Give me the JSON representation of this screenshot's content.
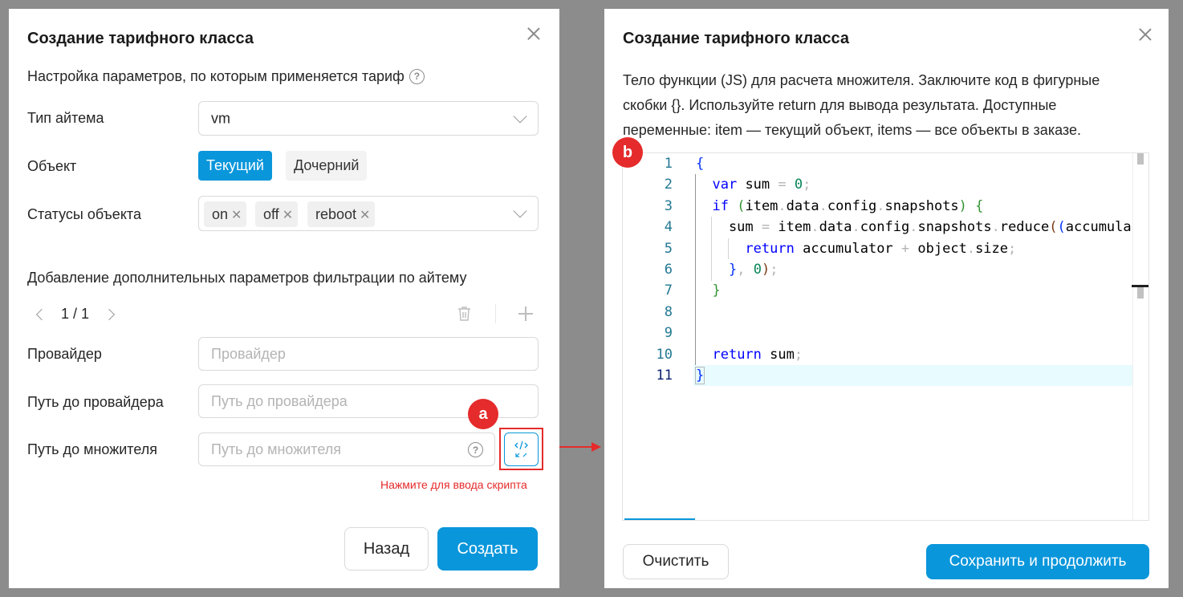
{
  "left_modal": {
    "title": "Создание тарифного класса",
    "subtitle": "Настройка параметров, по которым применяется тариф",
    "item_type": {
      "label": "Тип айтема",
      "value": "vm"
    },
    "object": {
      "label": "Объект",
      "options": [
        "Текущий",
        "Дочерний"
      ],
      "selected": "Текущий"
    },
    "statuses": {
      "label": "Статусы объекта",
      "tags": [
        "on",
        "off",
        "reboot"
      ]
    },
    "extra_section": "Добавление дополнительных параметров фильтрации по айтему",
    "pager": "1 / 1",
    "provider": {
      "label": "Провайдер",
      "placeholder": "Провайдер"
    },
    "provider_path": {
      "label": "Путь до провайдера",
      "placeholder": "Путь до провайдера"
    },
    "multiplier_path": {
      "label": "Путь до множителя",
      "placeholder": "Путь до множителя"
    },
    "script_hint": "Нажмите для ввода скрипта",
    "back_label": "Назад",
    "create_label": "Создать",
    "badge": "a"
  },
  "right_modal": {
    "title": "Создание тарифного класса",
    "description_lines": [
      "Тело функции (JS) для расчета множителя. Заключите код в фигурные",
      "скобки {}. Используйте return для вывода результата. Доступные",
      "переменные: item — текущий объект, items — все объекты в заказе."
    ],
    "badge": "b",
    "line_numbers": [
      "1",
      "2",
      "3",
      "4",
      "5",
      "6",
      "7",
      "8",
      "9",
      "10",
      "11"
    ],
    "active_line": 11,
    "code_lines": [
      "{",
      "  var sum = 0;",
      "  if (item.data.config.snapshots) {",
      "    sum = item.data.config.snapshots.reduce((accumula",
      "      return accumulator + object.size;",
      "    }, 0);",
      "  }",
      "",
      "",
      "  return sum;",
      "}"
    ],
    "clear_label": "Очистить",
    "save_label": "Сохранить и продолжить"
  },
  "colors": {
    "primary": "#0a96db",
    "annotation_red": "#e52b2b",
    "background": "#8c8c8c"
  }
}
